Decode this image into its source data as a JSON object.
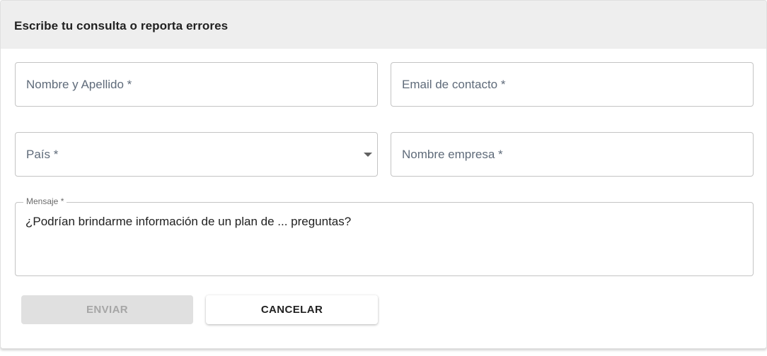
{
  "header": {
    "title": "Escribe tu consulta o reporta errores"
  },
  "form": {
    "name_placeholder": "Nombre y Apellido *",
    "email_placeholder": "Email de contacto *",
    "country_placeholder": "País *",
    "company_placeholder": "Nombre empresa *",
    "message_label": "Mensaje *",
    "message_value": "¿Podrían brindarme información de un plan de ... preguntas?"
  },
  "actions": {
    "send_label": "ENVIAR",
    "send_disabled": true,
    "cancel_label": "CANCELAR"
  },
  "icons": {
    "country_select": "caret-down-icon"
  },
  "colors": {
    "header_bg": "#eeeeee",
    "field_border": "#c4c4c4",
    "placeholder_text": "#5f6b7a",
    "disabled_button_bg": "#e0e0e0",
    "disabled_button_text": "#a6a6a6"
  }
}
